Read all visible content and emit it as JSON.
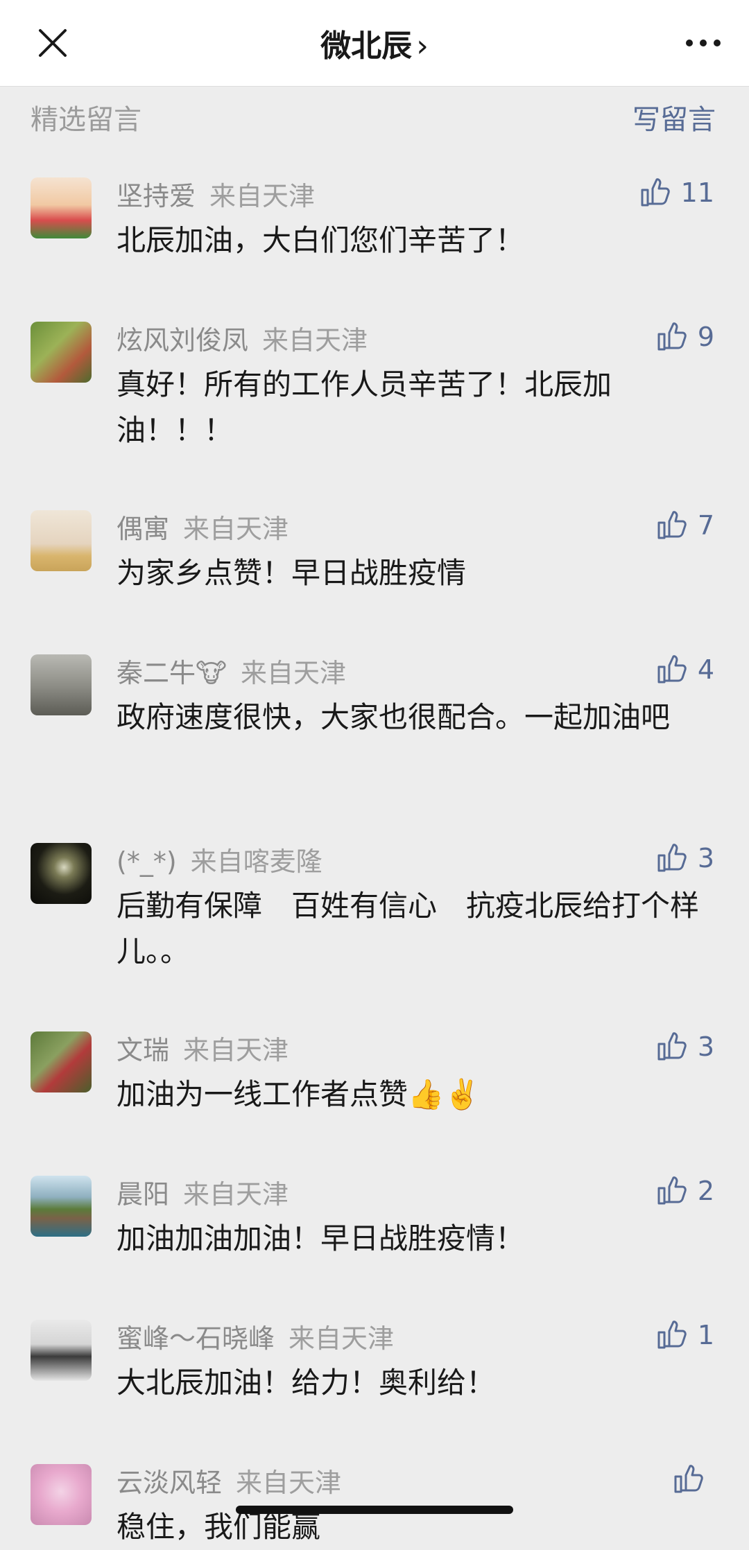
{
  "header": {
    "title": "微北辰",
    "title_chevron": "›",
    "close_icon": "close-icon",
    "more_icon": "more-icon"
  },
  "section": {
    "left_label": "精选留言",
    "right_label": "写留言"
  },
  "comments": [
    {
      "name": "坚持爱",
      "location": "来自天津",
      "likes": "11",
      "text": "北辰加油，大白们您们辛苦了！"
    },
    {
      "name": "炫风刘俊凤",
      "location": "来自天津",
      "likes": "9",
      "text": "真好！所有的工作人员辛苦了！北辰加油！！！"
    },
    {
      "name": "偶寓",
      "location": "来自天津",
      "likes": "7",
      "text": "为家乡点赞！早日战胜疫情"
    },
    {
      "name": "秦二牛🐮",
      "location": "来自天津",
      "likes": "4",
      "text": "政府速度很快，大家也很配合。一起加油吧"
    },
    {
      "name": "(*_*)",
      "location": "来自喀麦隆",
      "likes": "3",
      "text": "后勤有保障　百姓有信心　抗疫北辰给打个样儿。。"
    },
    {
      "name": "文瑞",
      "location": "来自天津",
      "likes": "3",
      "text": "加油为一线工作者点赞👍✌️"
    },
    {
      "name": "晨阳",
      "location": "来自天津",
      "likes": "2",
      "text": "加油加油加油！早日战胜疫情！"
    },
    {
      "name": "蜜峰～石晓峰",
      "location": "来自天津",
      "likes": "1",
      "text": "大北辰加油！给力！奥利给！"
    },
    {
      "name": "云淡风轻",
      "location": "来自天津",
      "likes": "",
      "text": "稳住，我们能赢"
    }
  ],
  "colors": {
    "background": "#ededed",
    "link": "#576b95",
    "meta": "#8a8a8a"
  }
}
